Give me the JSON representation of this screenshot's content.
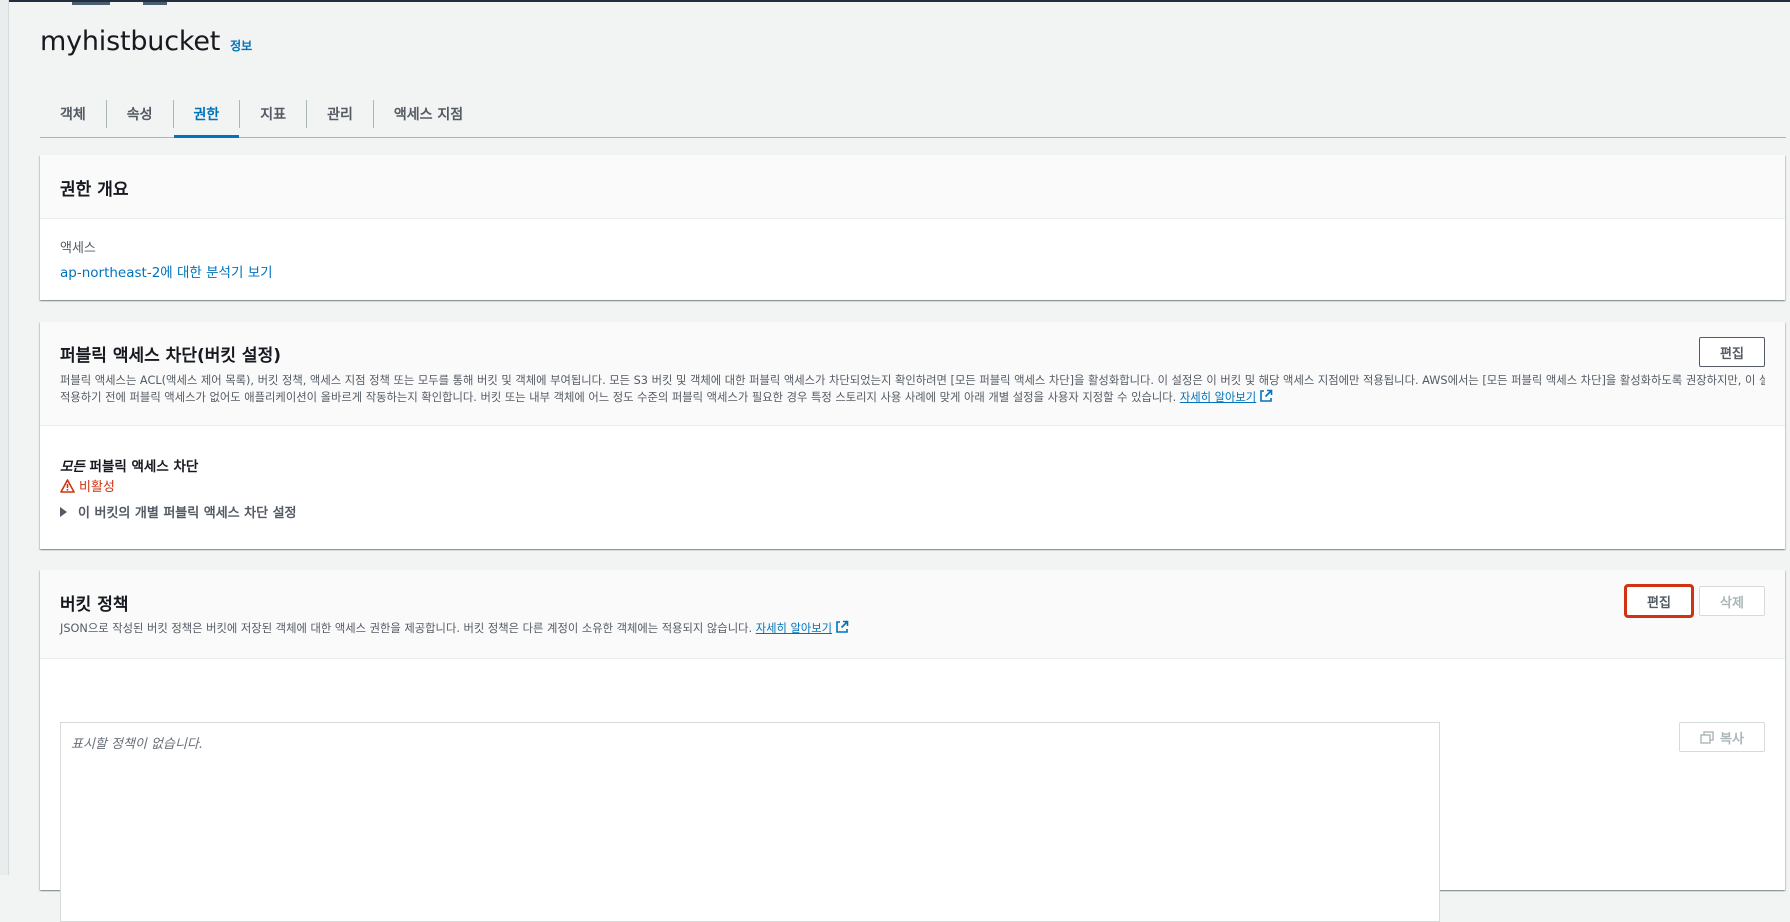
{
  "header": {
    "bucket_name": "myhistbucket",
    "info_label": "정보"
  },
  "tabs": [
    {
      "label": "객체",
      "active": false
    },
    {
      "label": "속성",
      "active": false
    },
    {
      "label": "권한",
      "active": true
    },
    {
      "label": "지표",
      "active": false
    },
    {
      "label": "관리",
      "active": false
    },
    {
      "label": "액세스 지점",
      "active": false
    }
  ],
  "permissions_overview": {
    "title": "권한 개요",
    "access_label": "액세스",
    "access_link": "ap-northeast-2에 대한 분석기 보기"
  },
  "block_public_access": {
    "title": "퍼블릭 액세스 차단(버킷 설정)",
    "description_line1": "퍼블릭 액세스는 ACL(액세스 제어 목록), 버킷 정책, 액세스 지점 정책 또는 모두를 통해 버킷 및 객체에 부여됩니다. 모든 S3 버킷 및 객체에 대한 퍼블릭 액세스가 차단되었는지 확인하려면 [모든 퍼블릭 액세스 차단]을 활성화합니다. 이 설정은 이 버킷 및 해당 액세스 지점에만 적용됩니다. AWS에서는 [모든 퍼블릭 액세스 차단]을 활성화하도록 권장하지만, 이 설정을",
    "description_line2": "적용하기 전에 퍼블릭 액세스가 없어도 애플리케이션이 올바르게 작동하는지 확인합니다. 버킷 또는 내부 객체에 어느 정도 수준의 퍼블릭 액세스가 필요한 경우 특정 스토리지 사용 사례에 맞게 아래 개별 설정을 사용자 지정할 수 있습니다.",
    "learn_more": "자세히 알아보기",
    "edit_button": "편집",
    "setting_prefix": "모든",
    "setting_label": " 퍼블릭 액세스 차단",
    "status": "비활성",
    "expander_label": "이 버킷의 개별 퍼블릭 액세스 차단 설정"
  },
  "bucket_policy": {
    "title": "버킷 정책",
    "description": "JSON으로 작성된 버킷 정책은 버킷에 저장된 객체에 대한 액세스 권한을 제공합니다. 버킷 정책은 다른 계정이 소유한 객체에는 적용되지 않습니다.",
    "learn_more": "자세히 알아보기",
    "edit_button": "편집",
    "delete_button": "삭제",
    "empty_text": "표시할 정책이 없습니다.",
    "copy_button": "복사"
  },
  "colors": {
    "accent": "#0073bb",
    "warning": "#d13212",
    "highlight_border": "#d13212"
  }
}
